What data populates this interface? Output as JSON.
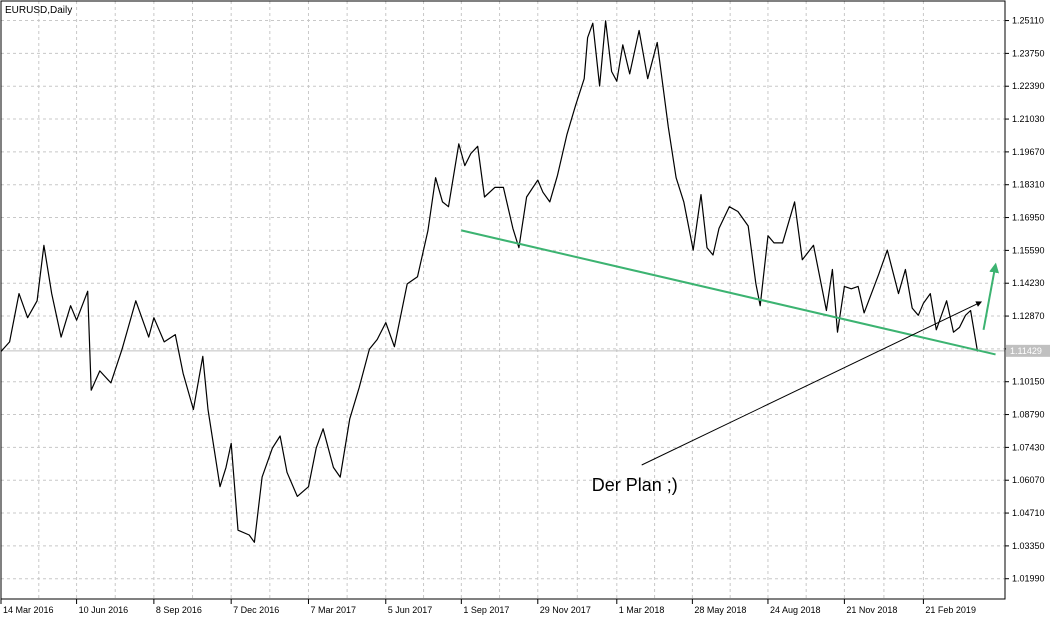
{
  "chart_data": {
    "type": "line",
    "title": "EURUSD,Daily",
    "symbol": "EURUSD",
    "timeframe": "Daily",
    "y_ticks": [
      "1.25110",
      "1.23750",
      "1.22390",
      "1.21030",
      "1.19670",
      "1.18310",
      "1.16950",
      "1.15590",
      "1.14230",
      "1.12870",
      "1.11510",
      "1.10150",
      "1.08790",
      "1.07430",
      "1.06070",
      "1.04710",
      "1.03350",
      "1.01990"
    ],
    "x_ticks": [
      "14 Mar 2016",
      "10 Jun 2016",
      "8 Sep 2016",
      "7 Dec 2016",
      "7 Mar 2017",
      "5 Jun 2017",
      "1 Sep 2017",
      "29 Nov 2017",
      "1 Mar 2018",
      "28 May 2018",
      "24 Aug 2018",
      "21 Nov 2018",
      "21 Feb 2019"
    ],
    "ylim": [
      1.0115,
      1.2592
    ],
    "current_price": "1.11429",
    "current_price_value": 1.11429,
    "grid": true,
    "colors": {
      "background": "#ffffff",
      "price_line": "#000000",
      "grid": "#c8c8c8",
      "trend_line": "#3cb371",
      "forecast_arrow": "#3cb371",
      "annotation_arrow": "#000000",
      "price_box": "#c0c0c0"
    },
    "series": [
      {
        "values": [
          {
            "date": "2016-03-14",
            "close": 1.114
          },
          {
            "date": "2016-03-24",
            "close": 1.118
          },
          {
            "date": "2016-04-04",
            "close": 1.138
          },
          {
            "date": "2016-04-14",
            "close": 1.128
          },
          {
            "date": "2016-04-25",
            "close": 1.135
          },
          {
            "date": "2016-05-03",
            "close": 1.158
          },
          {
            "date": "2016-05-12",
            "close": 1.138
          },
          {
            "date": "2016-05-23",
            "close": 1.12
          },
          {
            "date": "2016-06-03",
            "close": 1.133
          },
          {
            "date": "2016-06-10",
            "close": 1.127
          },
          {
            "date": "2016-06-23",
            "close": 1.139
          },
          {
            "date": "2016-06-27",
            "close": 1.098
          },
          {
            "date": "2016-07-07",
            "close": 1.106
          },
          {
            "date": "2016-07-20",
            "close": 1.101
          },
          {
            "date": "2016-08-02",
            "close": 1.115
          },
          {
            "date": "2016-08-18",
            "close": 1.135
          },
          {
            "date": "2016-09-02",
            "close": 1.12
          },
          {
            "date": "2016-09-08",
            "close": 1.128
          },
          {
            "date": "2016-09-20",
            "close": 1.118
          },
          {
            "date": "2016-10-03",
            "close": 1.121
          },
          {
            "date": "2016-10-12",
            "close": 1.105
          },
          {
            "date": "2016-10-24",
            "close": 1.09
          },
          {
            "date": "2016-11-04",
            "close": 1.112
          },
          {
            "date": "2016-11-10",
            "close": 1.09
          },
          {
            "date": "2016-11-24",
            "close": 1.058
          },
          {
            "date": "2016-12-01",
            "close": 1.066
          },
          {
            "date": "2016-12-07",
            "close": 1.076
          },
          {
            "date": "2016-12-15",
            "close": 1.04
          },
          {
            "date": "2016-12-28",
            "close": 1.038
          },
          {
            "date": "2017-01-03",
            "close": 1.035
          },
          {
            "date": "2017-01-12",
            "close": 1.062
          },
          {
            "date": "2017-01-24",
            "close": 1.074
          },
          {
            "date": "2017-02-02",
            "close": 1.079
          },
          {
            "date": "2017-02-10",
            "close": 1.064
          },
          {
            "date": "2017-02-22",
            "close": 1.054
          },
          {
            "date": "2017-03-07",
            "close": 1.058
          },
          {
            "date": "2017-03-16",
            "close": 1.074
          },
          {
            "date": "2017-03-24",
            "close": 1.082
          },
          {
            "date": "2017-04-05",
            "close": 1.066
          },
          {
            "date": "2017-04-13",
            "close": 1.062
          },
          {
            "date": "2017-04-24",
            "close": 1.086
          },
          {
            "date": "2017-05-05",
            "close": 1.099
          },
          {
            "date": "2017-05-17",
            "close": 1.115
          },
          {
            "date": "2017-05-26",
            "close": 1.119
          },
          {
            "date": "2017-06-05",
            "close": 1.126
          },
          {
            "date": "2017-06-15",
            "close": 1.116
          },
          {
            "date": "2017-06-30",
            "close": 1.142
          },
          {
            "date": "2017-07-12",
            "close": 1.145
          },
          {
            "date": "2017-07-24",
            "close": 1.164
          },
          {
            "date": "2017-08-02",
            "close": 1.186
          },
          {
            "date": "2017-08-10",
            "close": 1.176
          },
          {
            "date": "2017-08-17",
            "close": 1.174
          },
          {
            "date": "2017-08-29",
            "close": 1.2
          },
          {
            "date": "2017-09-05",
            "close": 1.191
          },
          {
            "date": "2017-09-12",
            "close": 1.196
          },
          {
            "date": "2017-09-20",
            "close": 1.199
          },
          {
            "date": "2017-09-28",
            "close": 1.178
          },
          {
            "date": "2017-10-10",
            "close": 1.182
          },
          {
            "date": "2017-10-20",
            "close": 1.182
          },
          {
            "date": "2017-10-31",
            "close": 1.165
          },
          {
            "date": "2017-11-07",
            "close": 1.157
          },
          {
            "date": "2017-11-16",
            "close": 1.178
          },
          {
            "date": "2017-11-29",
            "close": 1.185
          },
          {
            "date": "2017-12-05",
            "close": 1.18
          },
          {
            "date": "2017-12-13",
            "close": 1.176
          },
          {
            "date": "2017-12-22",
            "close": 1.187
          },
          {
            "date": "2018-01-02",
            "close": 1.204
          },
          {
            "date": "2018-01-12",
            "close": 1.216
          },
          {
            "date": "2018-01-22",
            "close": 1.227
          },
          {
            "date": "2018-01-26",
            "close": 1.244
          },
          {
            "date": "2018-02-01",
            "close": 1.25
          },
          {
            "date": "2018-02-09",
            "close": 1.224
          },
          {
            "date": "2018-02-16",
            "close": 1.251
          },
          {
            "date": "2018-02-23",
            "close": 1.23
          },
          {
            "date": "2018-03-01",
            "close": 1.226
          },
          {
            "date": "2018-03-08",
            "close": 1.241
          },
          {
            "date": "2018-03-16",
            "close": 1.229
          },
          {
            "date": "2018-03-27",
            "close": 1.247
          },
          {
            "date": "2018-04-06",
            "close": 1.227
          },
          {
            "date": "2018-04-17",
            "close": 1.242
          },
          {
            "date": "2018-04-23",
            "close": 1.226
          },
          {
            "date": "2018-04-30",
            "close": 1.207
          },
          {
            "date": "2018-05-09",
            "close": 1.186
          },
          {
            "date": "2018-05-18",
            "close": 1.176
          },
          {
            "date": "2018-05-29",
            "close": 1.156
          },
          {
            "date": "2018-06-07",
            "close": 1.179
          },
          {
            "date": "2018-06-14",
            "close": 1.157
          },
          {
            "date": "2018-06-21",
            "close": 1.154
          },
          {
            "date": "2018-06-28",
            "close": 1.165
          },
          {
            "date": "2018-07-10",
            "close": 1.174
          },
          {
            "date": "2018-07-20",
            "close": 1.172
          },
          {
            "date": "2018-08-01",
            "close": 1.166
          },
          {
            "date": "2018-08-10",
            "close": 1.142
          },
          {
            "date": "2018-08-15",
            "close": 1.133
          },
          {
            "date": "2018-08-24",
            "close": 1.162
          },
          {
            "date": "2018-08-31",
            "close": 1.159
          },
          {
            "date": "2018-09-10",
            "close": 1.159
          },
          {
            "date": "2018-09-24",
            "close": 1.176
          },
          {
            "date": "2018-10-03",
            "close": 1.152
          },
          {
            "date": "2018-10-16",
            "close": 1.158
          },
          {
            "date": "2018-10-31",
            "close": 1.131
          },
          {
            "date": "2018-11-07",
            "close": 1.148
          },
          {
            "date": "2018-11-13",
            "close": 1.122
          },
          {
            "date": "2018-11-21",
            "close": 1.141
          },
          {
            "date": "2018-11-29",
            "close": 1.14
          },
          {
            "date": "2018-12-07",
            "close": 1.141
          },
          {
            "date": "2018-12-14",
            "close": 1.13
          },
          {
            "date": "2018-12-31",
            "close": 1.146
          },
          {
            "date": "2019-01-10",
            "close": 1.156
          },
          {
            "date": "2019-01-23",
            "close": 1.138
          },
          {
            "date": "2019-01-31",
            "close": 1.148
          },
          {
            "date": "2019-02-08",
            "close": 1.132
          },
          {
            "date": "2019-02-15",
            "close": 1.129
          },
          {
            "date": "2019-02-21",
            "close": 1.134
          },
          {
            "date": "2019-03-01",
            "close": 1.138
          },
          {
            "date": "2019-03-08",
            "close": 1.123
          },
          {
            "date": "2019-03-20",
            "close": 1.135
          },
          {
            "date": "2019-03-28",
            "close": 1.122
          },
          {
            "date": "2019-04-04",
            "close": 1.124
          },
          {
            "date": "2019-04-11",
            "close": 1.129
          },
          {
            "date": "2019-04-17",
            "close": 1.131
          },
          {
            "date": "2019-04-25",
            "close": 1.114
          }
        ]
      }
    ],
    "drawings": {
      "trend_line": {
        "start": {
          "date": "2017-09-01",
          "price": 1.1642
        },
        "end": {
          "date": "2019-05-16",
          "price": 1.1128
        }
      },
      "forecast_arrow": {
        "start": {
          "date": "2019-05-02",
          "price": 1.123
        },
        "end": {
          "date": "2019-05-16",
          "price": 1.15
        }
      },
      "annotation": {
        "text": "Der Plan ;)",
        "line_start": {
          "date": "2018-03-30",
          "price": 1.067
        },
        "arrow_tip": {
          "date": "2019-04-29",
          "price": 1.1345
        }
      }
    }
  }
}
